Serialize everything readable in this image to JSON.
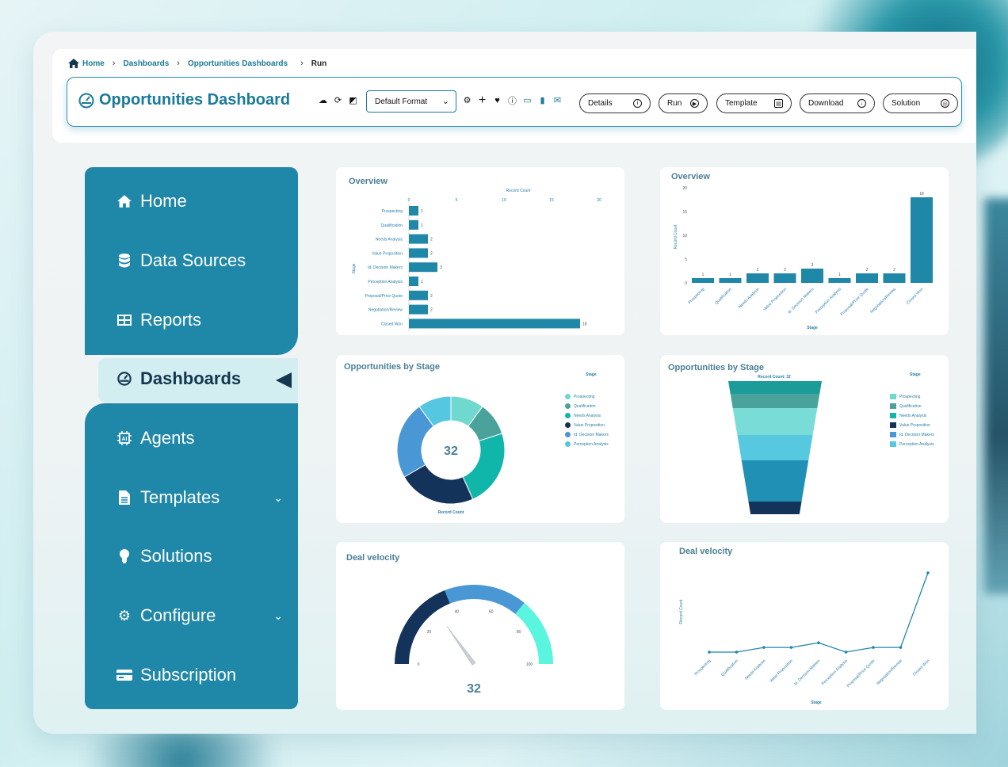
{
  "breadcrumb": [
    "Home",
    "Dashboards",
    "Opportunities Dashboards",
    "Run"
  ],
  "header": {
    "title": "Opportunities Dashboard",
    "format_select": "Default Format",
    "buttons": [
      "Details",
      "Run",
      "Template",
      "Download",
      "Solution"
    ]
  },
  "sidebar": {
    "items": [
      {
        "label": "Home",
        "icon": "home-icon"
      },
      {
        "label": "Data Sources",
        "icon": "database-icon"
      },
      {
        "label": "Reports",
        "icon": "table-icon"
      },
      {
        "label": "Dashboards",
        "icon": "dashboard-icon",
        "active": true
      },
      {
        "label": "Agents",
        "icon": "ai-chip-icon"
      },
      {
        "label": "Templates",
        "icon": "file-icon",
        "expandable": true
      },
      {
        "label": "Solutions",
        "icon": "lightbulb-icon"
      },
      {
        "label": "Configure",
        "icon": "gear-icon",
        "expandable": true
      },
      {
        "label": "Subscription",
        "icon": "credit-card-icon"
      }
    ]
  },
  "colors": {
    "accent": "#1f87a7",
    "active_text": "#14374f",
    "bar": "#1f87a7"
  },
  "chart_data": [
    {
      "type": "bar",
      "orientation": "horizontal",
      "title": "Overview",
      "xlabel": "Record Count",
      "ylabel": "Stage",
      "xlim": [
        0,
        20
      ],
      "x_ticks": [
        "0",
        "5",
        "10",
        "15",
        "20"
      ],
      "categories": [
        "Prospecting",
        "Qualification",
        "Needs Analysis",
        "Value Proposition",
        "Id. Decision Makers",
        "Perception Analysis",
        "Proposal/Price Quote",
        "Negotiation/Review",
        "Closed Won"
      ],
      "values": [
        1,
        1,
        2,
        2,
        3,
        1,
        2,
        2,
        18
      ]
    },
    {
      "type": "bar",
      "orientation": "vertical",
      "title": "Overview",
      "xlabel": "Stage",
      "ylabel": "Record Count",
      "ylim": [
        0,
        20
      ],
      "y_ticks": [
        "0",
        "5",
        "10",
        "15",
        "20"
      ],
      "categories": [
        "Prospecting",
        "Qualification",
        "Needs Analysis",
        "Value Proposition",
        "Id. Decision Makers",
        "Perception Analysis",
        "Proposal/Price Quote",
        "Negotiation/Review",
        "Closed Won"
      ],
      "values": [
        1,
        1,
        2,
        2,
        3,
        1,
        2,
        2,
        18
      ]
    },
    {
      "type": "pie",
      "donut": true,
      "title": "Opportunities by Stage",
      "center_value": "32",
      "xlabel": "Record Count",
      "legend_title": "Stage",
      "categories": [
        "Prospecting",
        "Qualification",
        "Needs Analysis",
        "Value Proposition",
        "Id. Decision Makers",
        "Perception Analysis"
      ],
      "colors": [
        "#6fd9d0",
        "#4aa39a",
        "#11b6ab",
        "#14335a",
        "#4a97d6",
        "#56c7e0"
      ],
      "values": [
        3,
        3,
        7,
        7,
        7,
        3
      ]
    },
    {
      "type": "funnel",
      "title": "Opportunities by Stage",
      "subtitle": "Record Count: 32",
      "legend_title": "Stage",
      "categories": [
        "Prospecting",
        "Qualification",
        "Needs Analysis",
        "Value Proposition",
        "Id. Decision Makers",
        "Perception Analysis"
      ],
      "colors": [
        "#1b9c98",
        "#4aa39a",
        "#7adcd6",
        "#56c9e0",
        "#2090b5",
        "#14335a"
      ]
    },
    {
      "type": "gauge",
      "title": "Deal velocity",
      "value": 32,
      "min": 0,
      "max": 100,
      "ticks": [
        "0",
        "20",
        "40",
        "60",
        "80",
        "100"
      ]
    },
    {
      "type": "line",
      "title": "Deal velocity",
      "xlabel": "Stage",
      "ylabel": "Record Count",
      "categories": [
        "Prospecting",
        "Qualification",
        "Needs Analysis",
        "Value Proposition",
        "Id. Decision Makers",
        "Perception Analysis",
        "Proposal/Price Quote",
        "Negotiation/Review",
        "Closed Won"
      ],
      "values": [
        1,
        1,
        2,
        2,
        3,
        1,
        2,
        2,
        18
      ]
    }
  ]
}
